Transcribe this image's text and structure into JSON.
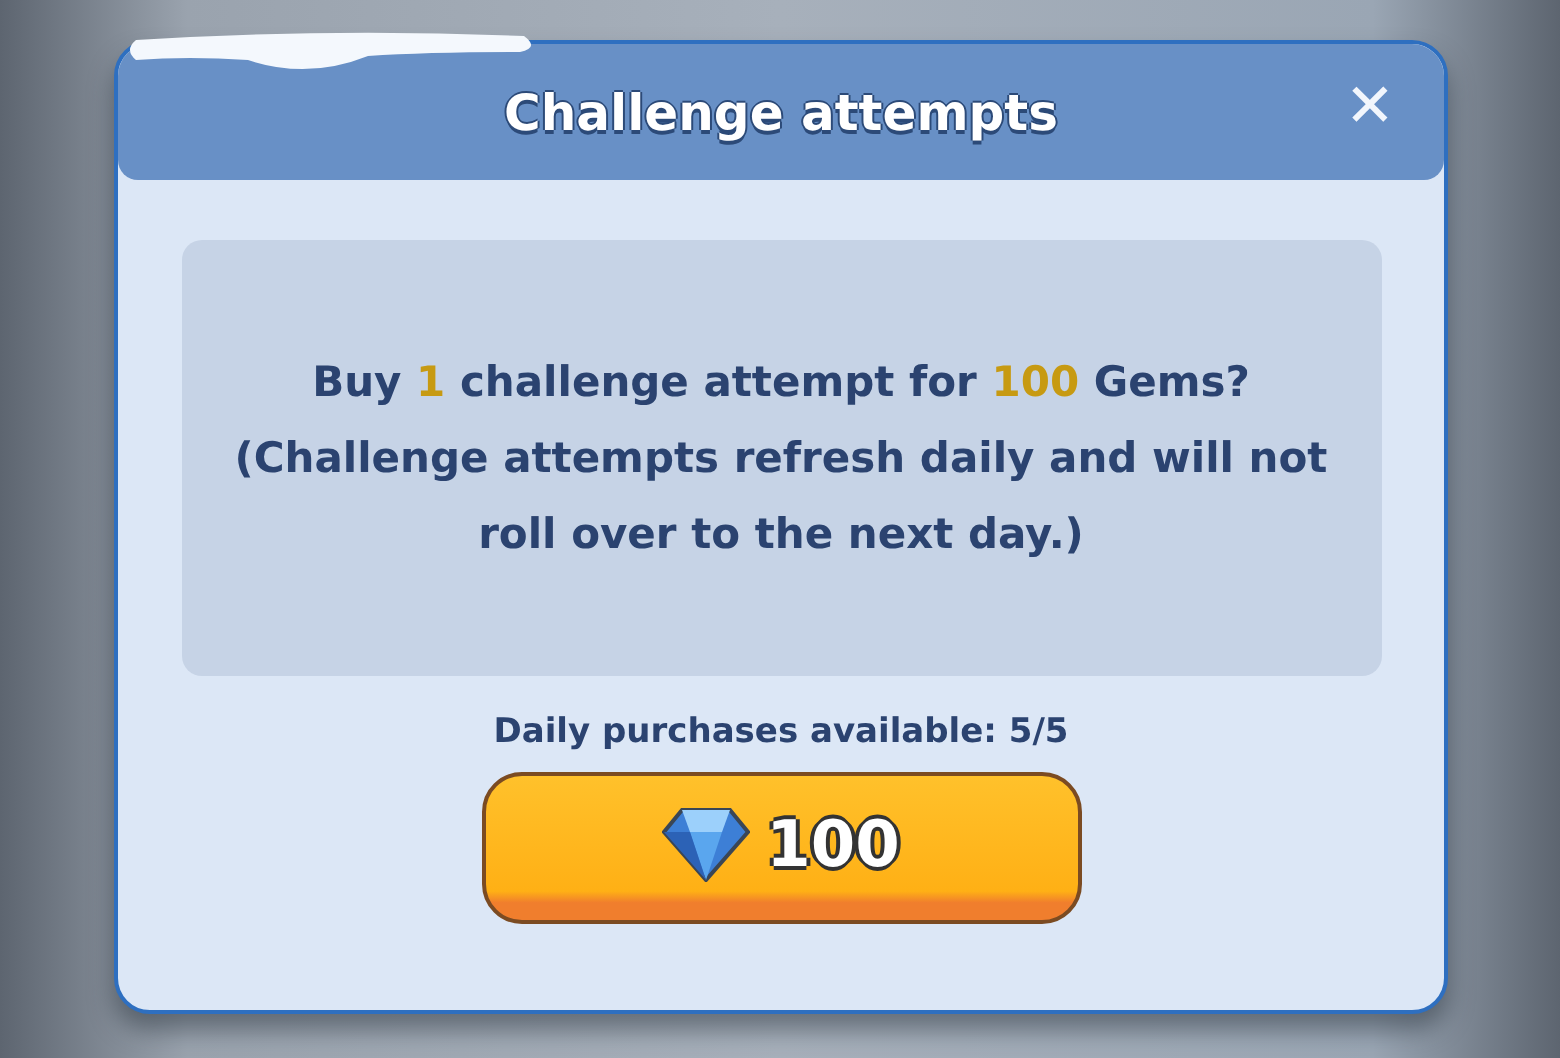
{
  "dialog": {
    "title": "Challenge attempts",
    "close_icon": "✕"
  },
  "message": {
    "question": "Buy **1** challenge attempt for **100** Gems?",
    "note": "(Challenge attempts refresh daily and will not roll over to the next day.)"
  },
  "daily_purchases": "Daily purchases available: 5/5",
  "buy_button": {
    "price": "100"
  }
}
